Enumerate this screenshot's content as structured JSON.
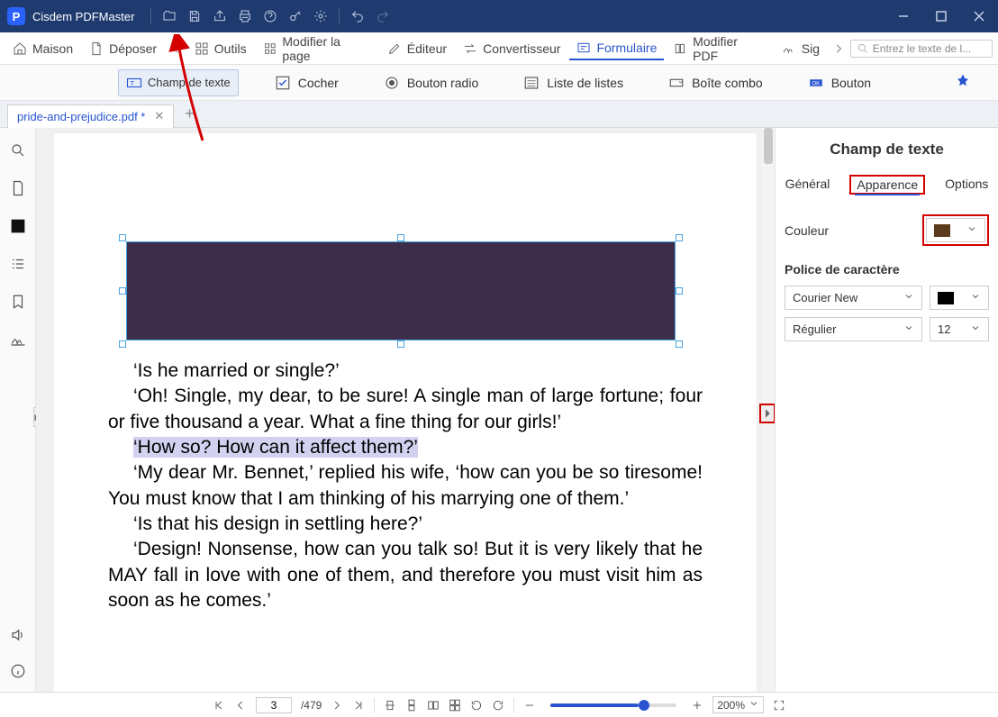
{
  "app": {
    "title": "Cisdem PDFMaster"
  },
  "mainTabs": {
    "home": "Maison",
    "deposit": "Déposer",
    "tools": "Outils",
    "modify_page": "Modifier la page",
    "editor": "Éditeur",
    "converter": "Convertisseur",
    "form": "Formulaire",
    "modify_pdf": "Modifier PDF",
    "sig": "Sig"
  },
  "search": {
    "placeholder": "Entrez le texte de l..."
  },
  "formTools": {
    "textfield": "Champ de texte",
    "check": "Cocher",
    "radio": "Bouton radio",
    "listbox": "Liste de listes",
    "combo": "Boîte combo",
    "button": "Bouton"
  },
  "docTab": {
    "name": "pride-and-prejudice.pdf *"
  },
  "page": {
    "line1": "‘Is he married or single?’",
    "line2": "‘Oh! Single, my dear, to be sure! A single man of large fortune; four or five thousand a year. What a fine thing for our girls!’",
    "line3": "‘How so? How can it affect them?’",
    "line4": "‘My dear Mr. Bennet,’ replied his wife, ‘how can you be so tiresome! You must know that I am thinking of his marrying one of them.’",
    "line5": "‘Is that his design in settling here?’",
    "line6": "‘Design! Nonsense, how can you talk so! But it is very likely that he MAY fall in love with one of them, and therefore you must visit him as soon as he comes.’"
  },
  "rightPanel": {
    "title": "Champ de texte",
    "tabs": {
      "general": "Général",
      "appearance": "Apparence",
      "options": "Options"
    },
    "color_label": "Couleur",
    "color_value": "#5a3b1e",
    "font_section": "Police de caractère",
    "font_name": "Courier New",
    "font_color": "#000000",
    "font_weight": "Régulier",
    "font_size": "12"
  },
  "bottom": {
    "page_current": "3",
    "page_total": "/479",
    "zoom": "200%"
  }
}
